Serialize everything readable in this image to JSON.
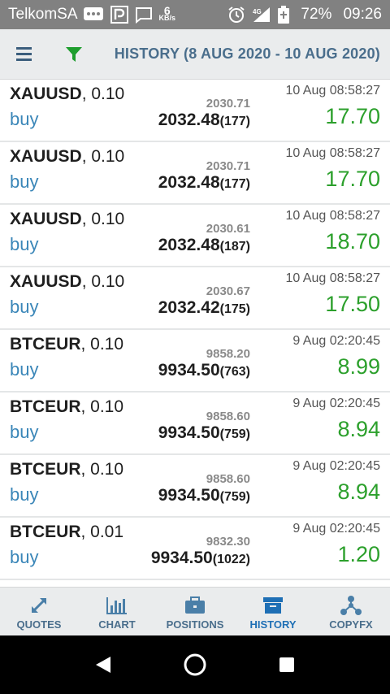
{
  "status_bar": {
    "carrier": "TelkomSA",
    "net_speed_value": "6",
    "net_speed_unit": "KB/s",
    "signal_label": "4G",
    "battery": "72%",
    "time": "09:26"
  },
  "toolbar": {
    "title": "HISTORY (8 AUG 2020 - 10 AUG 2020)"
  },
  "trades": [
    {
      "symbol": "XAUUSD",
      "volume": ", 0.10",
      "side": "buy",
      "open_price": "2030.71",
      "close_price": "2032.48",
      "points": "(177)",
      "time": "10 Aug 08:58:27",
      "profit": "17.70"
    },
    {
      "symbol": "XAUUSD",
      "volume": ", 0.10",
      "side": "buy",
      "open_price": "2030.71",
      "close_price": "2032.48",
      "points": "(177)",
      "time": "10 Aug 08:58:27",
      "profit": "17.70"
    },
    {
      "symbol": "XAUUSD",
      "volume": ", 0.10",
      "side": "buy",
      "open_price": "2030.61",
      "close_price": "2032.48",
      "points": "(187)",
      "time": "10 Aug 08:58:27",
      "profit": "18.70"
    },
    {
      "symbol": "XAUUSD",
      "volume": ", 0.10",
      "side": "buy",
      "open_price": "2030.67",
      "close_price": "2032.42",
      "points": "(175)",
      "time": "10 Aug 08:58:27",
      "profit": "17.50"
    },
    {
      "symbol": "BTCEUR",
      "volume": ", 0.10",
      "side": "buy",
      "open_price": "9858.20",
      "close_price": "9934.50",
      "points": "(763)",
      "time": "9 Aug 02:20:45",
      "profit": "8.99"
    },
    {
      "symbol": "BTCEUR",
      "volume": ", 0.10",
      "side": "buy",
      "open_price": "9858.60",
      "close_price": "9934.50",
      "points": "(759)",
      "time": "9 Aug 02:20:45",
      "profit": "8.94"
    },
    {
      "symbol": "BTCEUR",
      "volume": ", 0.10",
      "side": "buy",
      "open_price": "9858.60",
      "close_price": "9934.50",
      "points": "(759)",
      "time": "9 Aug 02:20:45",
      "profit": "8.94"
    },
    {
      "symbol": "BTCEUR",
      "volume": ", 0.01",
      "side": "buy",
      "open_price": "9832.30",
      "close_price": "9934.50",
      "points": "(1022)",
      "time": "9 Aug 02:20:45",
      "profit": "1.20"
    }
  ],
  "tabs": [
    {
      "label": "QUOTES",
      "icon": "arrows-icon"
    },
    {
      "label": "CHART",
      "icon": "bar-chart-icon"
    },
    {
      "label": "POSITIONS",
      "icon": "briefcase-icon"
    },
    {
      "label": "HISTORY",
      "icon": "archive-box-icon",
      "active": true
    },
    {
      "label": "COPYFX",
      "icon": "network-icon"
    }
  ],
  "colors": {
    "status_bar_bg": "#818181",
    "toolbar_bg": "#eaeced",
    "accent_blue": "#3a86b8",
    "profit_green": "#2ca02c",
    "title_color": "#4a6e8c",
    "active_tab": "#1e6fb5"
  }
}
